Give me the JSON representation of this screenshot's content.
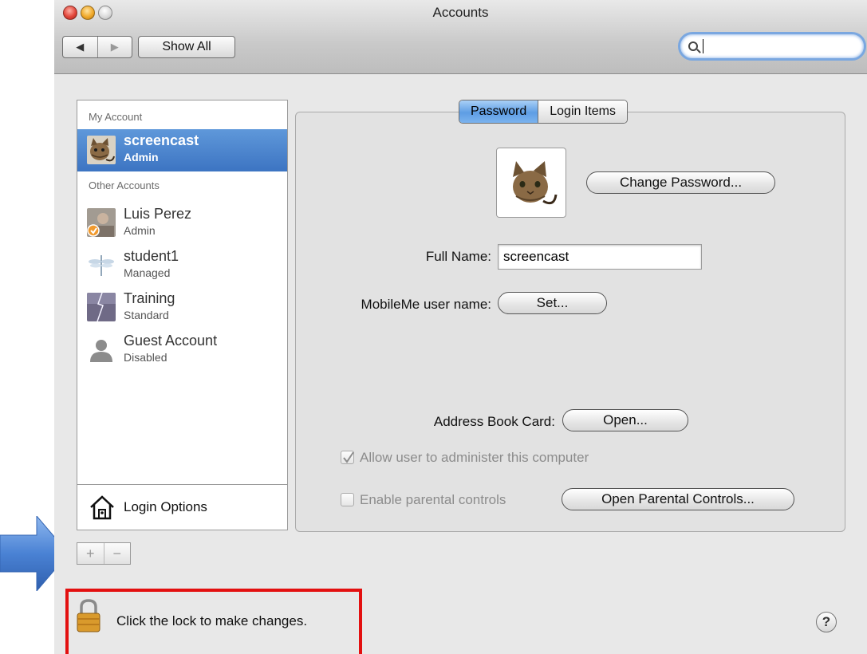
{
  "window": {
    "title": "Accounts",
    "toolbar": {
      "back_glyph": "◀",
      "forward_glyph": "▶",
      "show_all_label": "Show All",
      "search_value": ""
    }
  },
  "sidebar": {
    "my_account_header": "My Account",
    "selected_account": {
      "name": "screencast",
      "role": "Admin"
    },
    "other_accounts_header": "Other Accounts",
    "other_accounts": [
      {
        "name": "Luis Perez",
        "role": "Admin"
      },
      {
        "name": "student1",
        "role": "Managed"
      },
      {
        "name": "Training",
        "role": "Standard"
      },
      {
        "name": "Guest Account",
        "role": "Disabled"
      }
    ],
    "login_options_label": "Login Options",
    "add_glyph": "+",
    "remove_glyph": "−"
  },
  "tabs": [
    {
      "label": "Password",
      "active": true
    },
    {
      "label": "Login Items",
      "active": false
    }
  ],
  "password_pane": {
    "change_password_label": "Change Password...",
    "full_name_label": "Full Name:",
    "full_name_value": "screencast",
    "mobileme_label": "MobileMe user name:",
    "set_label": "Set...",
    "address_book_label": "Address Book Card:",
    "open_label": "Open...",
    "allow_admin_label": "Allow user to administer this computer",
    "allow_admin_checked": true,
    "parental_label": "Enable parental controls",
    "parental_checked": false,
    "open_parental_label": "Open Parental Controls..."
  },
  "footer": {
    "lock_text": "Click the lock to make changes.",
    "help_glyph": "?"
  },
  "colors": {
    "selection": "#3c74c2",
    "highlight_box": "#e31010",
    "arrow": "#4a82d4"
  }
}
